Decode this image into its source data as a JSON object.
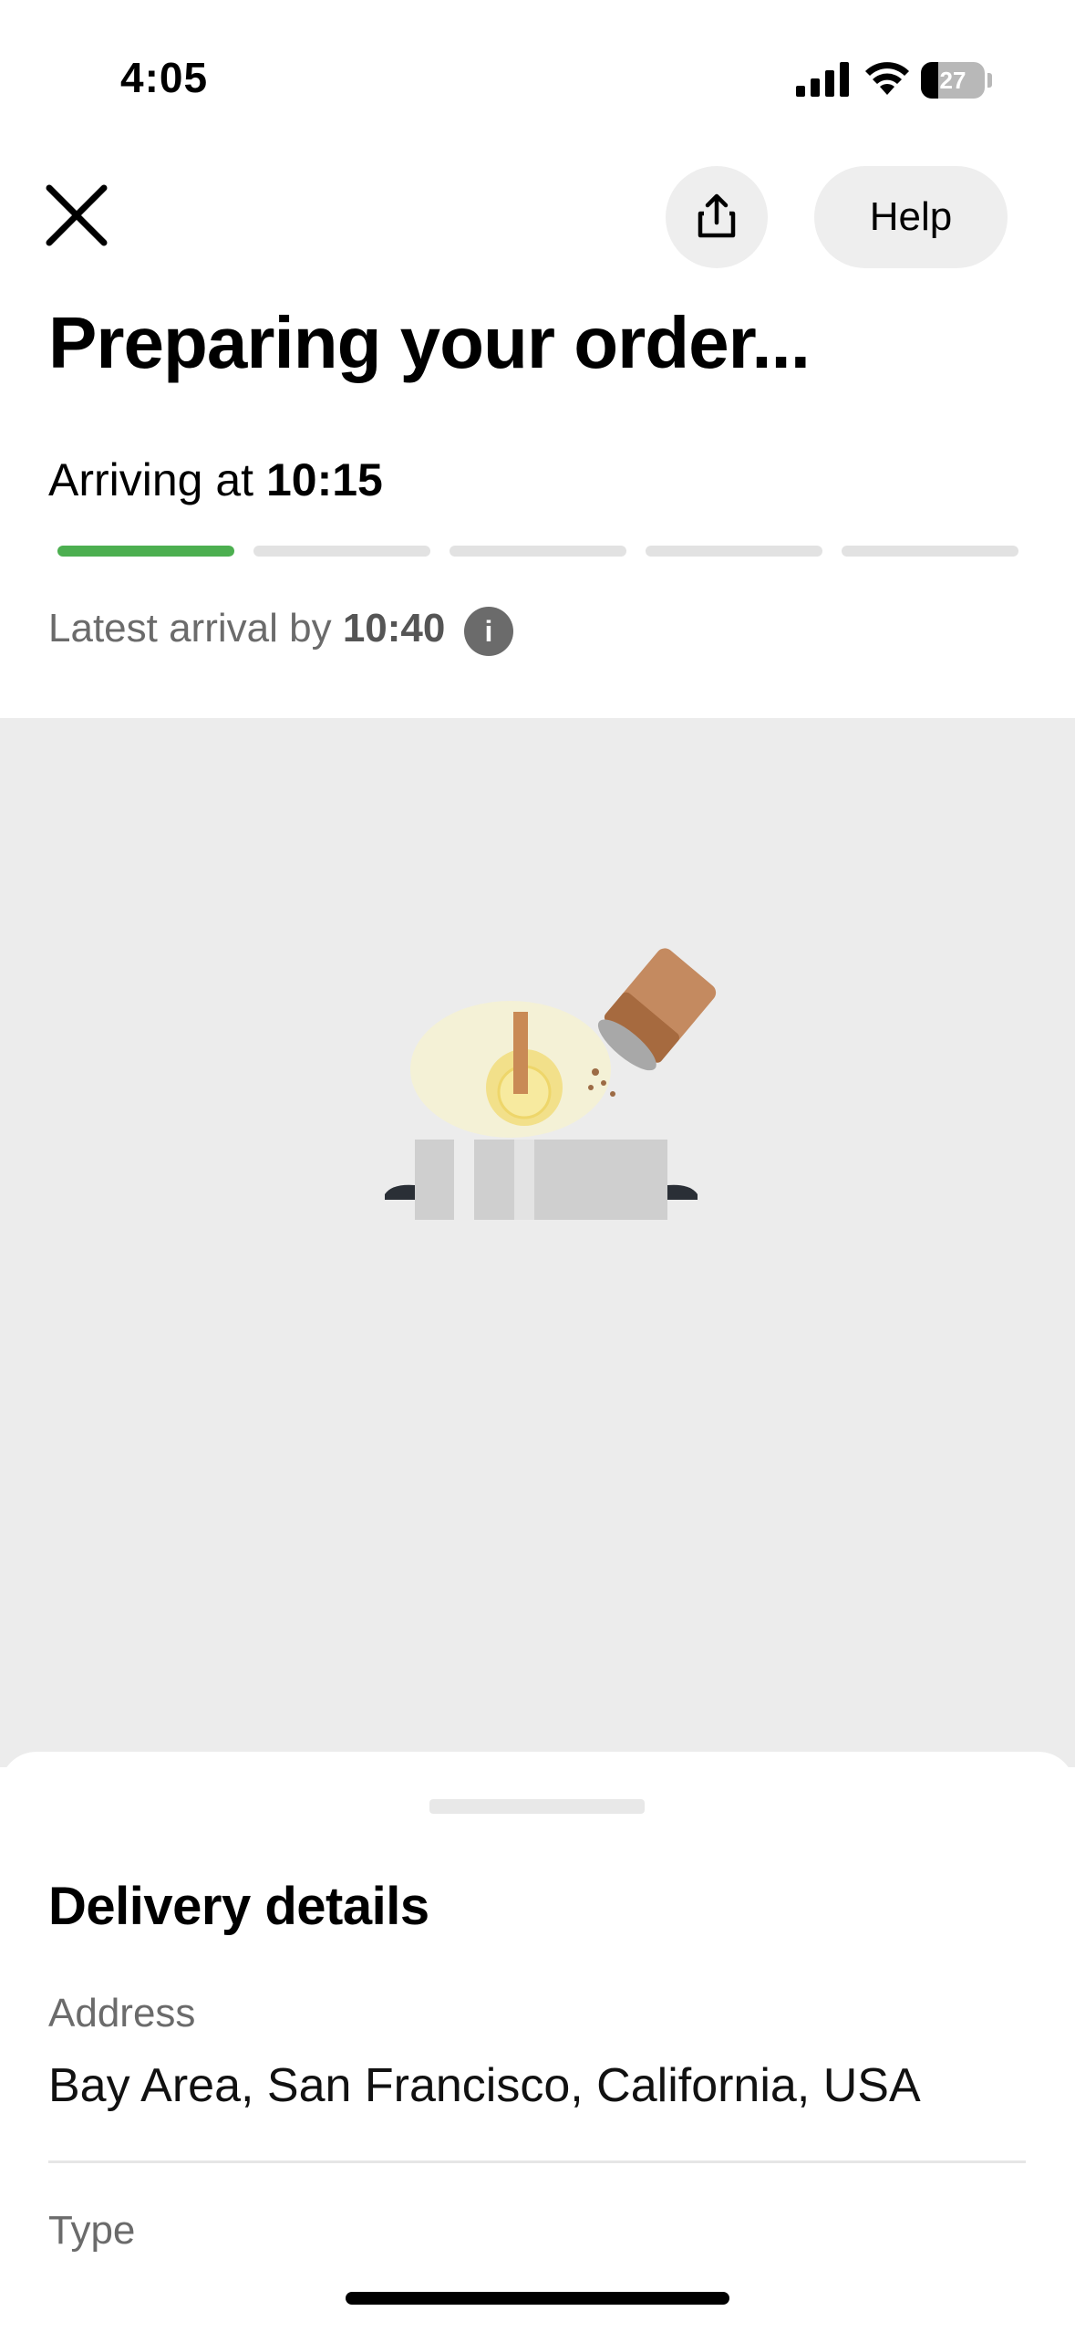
{
  "status_bar": {
    "time": "4:05",
    "battery_level": "27",
    "battery_fraction": 0.27,
    "icons": [
      "cellular-signal-icon",
      "wifi-icon",
      "battery-icon"
    ]
  },
  "header": {
    "close_icon": "close-icon",
    "share_icon": "share-icon",
    "help_label": "Help"
  },
  "order": {
    "title": "Preparing your order...",
    "arriving_prefix": "Arriving at",
    "arriving_time": "10:15",
    "progress_total_steps": 5,
    "progress_completed_steps": 1,
    "progress_active_color": "#4caf50",
    "latest_prefix": "Latest arrival by",
    "latest_time": "10:40",
    "info_glyph": "i"
  },
  "illustration": {
    "name": "cooking-pot-illustration",
    "background": "#ececec"
  },
  "delivery": {
    "title": "Delivery details",
    "address_label": "Address",
    "address_value": "Bay Area, San Francisco, California, USA",
    "type_label": "Type"
  }
}
